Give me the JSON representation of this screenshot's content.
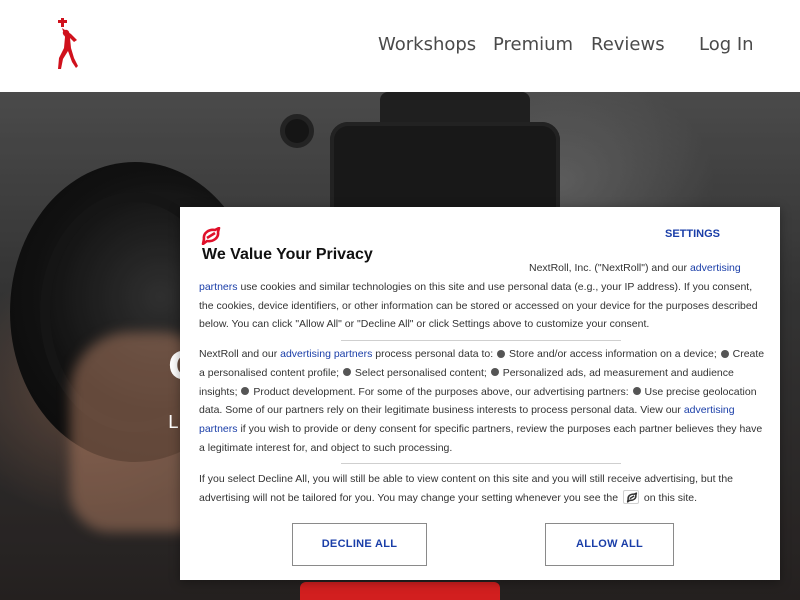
{
  "header": {
    "logo_icon": "red-sports-figure-logo",
    "nav": {
      "workshops": "Workshops",
      "premium": "Premium",
      "reviews": "Reviews",
      "login": "Log In"
    }
  },
  "hero": {
    "visible_fragment_1": "C",
    "visible_fragment_2": "L"
  },
  "consent": {
    "brand_color": "#e0102a",
    "accent_color": "#1a3ea8",
    "title": "We Value Your Privacy",
    "settings": "SETTINGS",
    "p1": {
      "t1": "NextRoll, Inc. (\"NextRoll\") and our ",
      "link1": "advertising partners",
      "t2": " use cookies and similar technologies on this site and use personal data (e.g., your IP address). If you consent, the cookies, device identifiers, or other information can be stored or accessed on your device for the purposes described below. You can click \"Allow All\" or \"Decline All\" or click Settings above to customize your consent."
    },
    "p2": {
      "t1": "NextRoll and our ",
      "link1": "advertising partners",
      "t2": " process personal data to: ",
      "t3": " Store and/or access information on a device; ",
      "t4": " Create a personalised content profile; ",
      "t5": " Select personalised content; ",
      "t6": " Personalized ads, ad measurement and audience insights; ",
      "t7": " Product development. For some of the purposes above, our advertising partners: ",
      "t8": " Use precise geolocation data. Some of our partners rely on their legitimate business interests to process personal data. View our ",
      "link2": "advertising partners",
      "t9": " if you wish to provide or deny consent for specific partners, review the purposes each partner believes they have a legitimate interest for, and object to such processing."
    },
    "p3": {
      "t1": "If you select Decline All, you will still be able to view content on this site and you will still receive advertising, but the advertising will not be tailored for you. You may change your setting whenever you see the ",
      "icon": "nextroll-consent-icon",
      "t2": " on this site."
    },
    "decline_label": "DECLINE ALL",
    "allow_label": "ALLOW ALL"
  }
}
